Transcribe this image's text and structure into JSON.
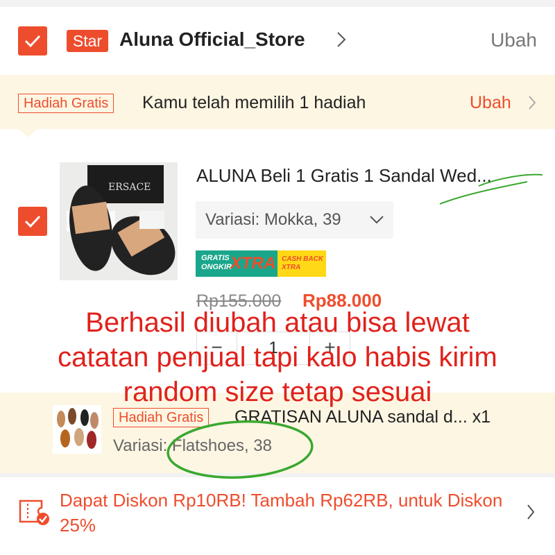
{
  "store": {
    "badge": "Star",
    "name": "Aluna Official_Store",
    "edit_label": "Ubah"
  },
  "gift_banner": {
    "tag": "Hadiah Gratis",
    "text": "Kamu telah memilih 1 hadiah",
    "action": "Ubah"
  },
  "product": {
    "title": "ALUNA Beli 1 Gratis 1 Sandal Wed...",
    "variation": "Variasi: Mokka, 39",
    "badge_free_shipping": "GRATIS ONGKIR",
    "badge_xtra": "XTRA",
    "badge_cashback": "CASH BACK XTRA",
    "price_original": "Rp155.000",
    "price_discounted": "Rp88.000",
    "quantity": "1",
    "qty_minus": "−",
    "qty_plus": "+",
    "image_text": "ERSACE"
  },
  "gift_item": {
    "tag": "Hadiah Gratis",
    "name": "GRATISAN ALUNA sandal d... x1",
    "variation": "Variasi: Flatshoes, 38"
  },
  "discount": {
    "text": "Dapat Diskon Rp10RB! Tambah Rp62RB, untuk Diskon 25%"
  },
  "annotation": {
    "line1": "Berhasil diubah atau bisa lewat",
    "line2": "catatan penjual tapi kalo habis kirim",
    "line3": "random size tetap sesuai"
  },
  "colors": {
    "accent": "#ee4d2d",
    "gift_bg": "#fdf6e3",
    "annotation_red": "#e0211b",
    "annotation_green": "#3aa830"
  }
}
